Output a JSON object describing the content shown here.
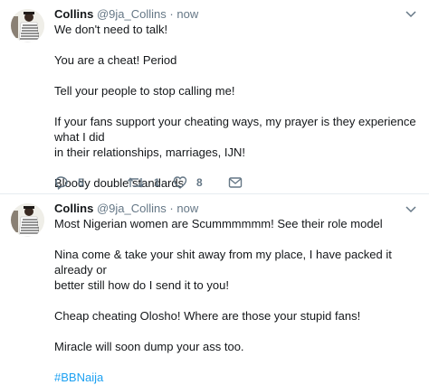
{
  "tweets": [
    {
      "author_name": "Collins",
      "author_handle": "@9ja_Collins",
      "separator": "·",
      "time": "now",
      "lines": [
        "We don't need to talk!",
        "You are a cheat! Period",
        "Tell your people to stop calling me!",
        "If your fans support your cheating ways, my prayer is they experience what I did",
        "in their relationships, marriages, IJN!",
        "Bloody double standards"
      ],
      "reply_count": "5",
      "retweet_count": "1",
      "like_count": "8"
    },
    {
      "author_name": "Collins",
      "author_handle": "@9ja_Collins",
      "separator": "·",
      "time": "now",
      "lines": [
        "Most Nigerian women are Scummmmmm! See their role model",
        "Nina come & take your shit away from my place, I have packed it already or",
        "better still how do I send it to you!",
        "Cheap cheating Olosho! Where are those your stupid fans!",
        "Miracle will soon dump your ass too.",
        "#BBNaija"
      ]
    }
  ],
  "icons": {
    "reply": "reply-icon",
    "retweet": "retweet-icon",
    "like": "like-icon",
    "share": "share-dm-icon",
    "caret": "chevron-down-icon"
  },
  "colors": {
    "text": "#14171a",
    "muted": "#657786",
    "link": "#1da1f2",
    "divider": "#e6ecf0"
  }
}
